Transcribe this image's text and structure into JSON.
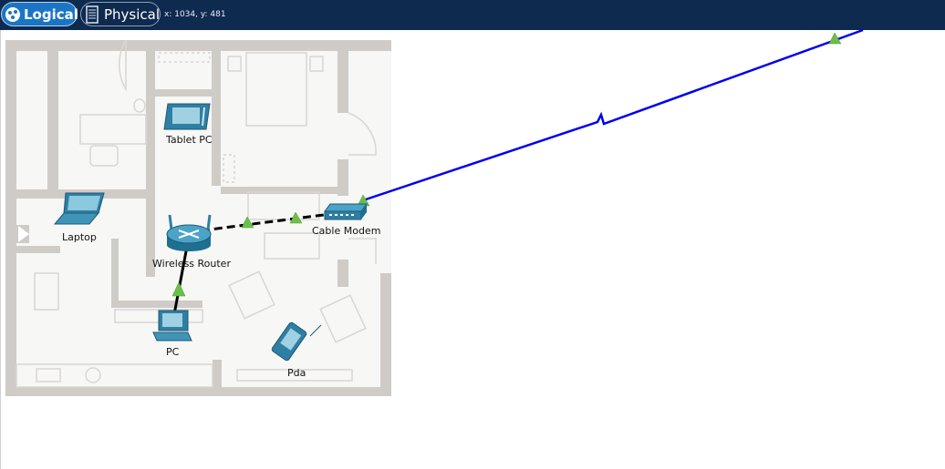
{
  "toolbar": {
    "logical_label": "Logical",
    "physical_label": "Physical",
    "coordinates": "x: 1034, y: 481"
  },
  "devices": {
    "tablet": "Tablet PC",
    "laptop": "Laptop",
    "router": "Wireless Router",
    "modem": "Cable Modem",
    "pc": "PC",
    "pda": "Pda"
  },
  "colors": {
    "topbar": "#0e2a4f",
    "active_tab": "#1a76c5",
    "link_up": "#6cc04a",
    "coax_cable": "#0000ee",
    "ethernet_cable": "#000000",
    "device_blue": "#2e7fa3"
  }
}
